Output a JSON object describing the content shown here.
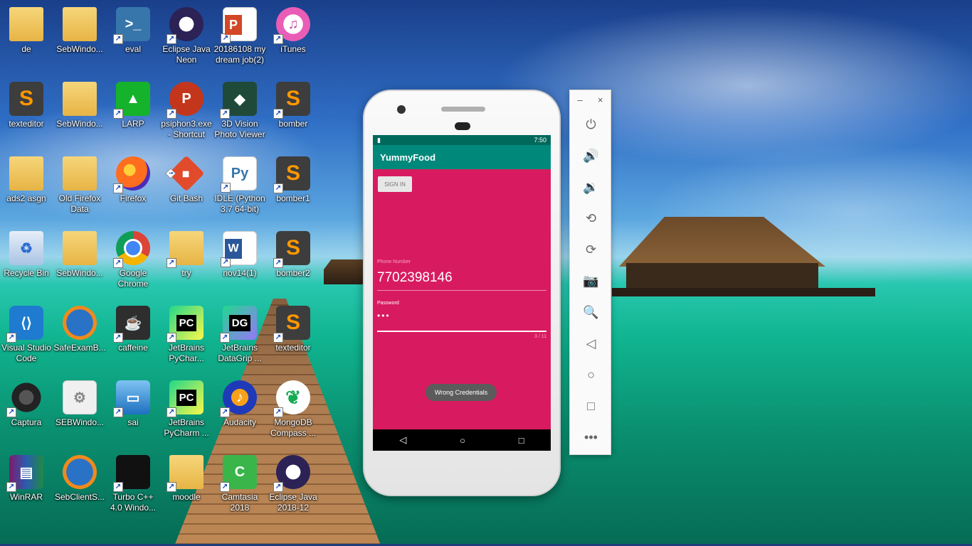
{
  "desktop": {
    "icons": [
      {
        "label": "de",
        "icon": "folder-icon"
      },
      {
        "label": "SebWindo...",
        "icon": "folder-icon"
      },
      {
        "label": "eval",
        "icon": "python-icon"
      },
      {
        "label": "Eclipse Java Neon",
        "icon": "eclipse-icon"
      },
      {
        "label": "20186108 my dream job(2)",
        "icon": "powerpoint-icon"
      },
      {
        "label": "iTunes",
        "icon": "itunes-icon"
      },
      {
        "label": "texteditor",
        "icon": "sublime-icon"
      },
      {
        "label": "SebWindo...",
        "icon": "folder-icon"
      },
      {
        "label": "LARP",
        "icon": "larp-icon"
      },
      {
        "label": "psiphon3.exe - Shortcut",
        "icon": "psiphon-icon"
      },
      {
        "label": "3D Vision Photo Viewer",
        "icon": "3d-vision-icon"
      },
      {
        "label": "bomber",
        "icon": "sublime-icon"
      },
      {
        "label": "ads2 asgn",
        "icon": "folder-icon"
      },
      {
        "label": "Old Firefox Data",
        "icon": "folder-icon"
      },
      {
        "label": "Firefox",
        "icon": "firefox-icon"
      },
      {
        "label": "Git Bash",
        "icon": "git-icon"
      },
      {
        "label": "IDLE (Python 3.7 64-bit)",
        "icon": "python-idle-icon"
      },
      {
        "label": "bomber1",
        "icon": "sublime-icon"
      },
      {
        "label": "Recycle Bin",
        "icon": "recycle-bin-icon"
      },
      {
        "label": "SebWindo...",
        "icon": "folder-icon"
      },
      {
        "label": "Google Chrome",
        "icon": "chrome-icon"
      },
      {
        "label": "try",
        "icon": "folder-icon"
      },
      {
        "label": "nov14(1)",
        "icon": "word-icon"
      },
      {
        "label": "bomber2",
        "icon": "sublime-icon"
      },
      {
        "label": "Visual Studio Code",
        "icon": "vscode-icon"
      },
      {
        "label": "SafeExamB...",
        "icon": "safe-exam-browser-icon"
      },
      {
        "label": "caffeine",
        "icon": "caffeine-icon"
      },
      {
        "label": "JetBrains PyChar...",
        "icon": "pycharm-icon"
      },
      {
        "label": "JetBrains DataGrip ...",
        "icon": "datagrip-icon"
      },
      {
        "label": "texteditor",
        "icon": "sublime-icon"
      },
      {
        "label": "Captura",
        "icon": "captura-icon"
      },
      {
        "label": "SEBWindo...",
        "icon": "settings-file-icon"
      },
      {
        "label": "sai",
        "icon": "computer-icon"
      },
      {
        "label": "JetBrains PyCharm ...",
        "icon": "pycharm-icon"
      },
      {
        "label": "Audacity",
        "icon": "audacity-icon"
      },
      {
        "label": "MongoDB Compass ...",
        "icon": "mongodb-icon"
      },
      {
        "label": "WinRAR",
        "icon": "winrar-icon"
      },
      {
        "label": "SebClientS...",
        "icon": "safe-exam-browser-icon"
      },
      {
        "label": "Turbo C++ 4.0 Windo...",
        "icon": "turbo-cpp-icon"
      },
      {
        "label": "moodle",
        "icon": "folder-icon"
      },
      {
        "label": "Camtasia 2018",
        "icon": "camtasia-icon"
      },
      {
        "label": "Eclipse Java 2018-12",
        "icon": "eclipse-icon"
      }
    ]
  },
  "emulator": {
    "status_time": "7:50",
    "app_title": "YummyFood",
    "sign_in_label": "SIGN IN",
    "phone_label": "Phone Number",
    "phone_value": "7702398146",
    "password_label": "Password",
    "password_value": "•••",
    "password_counter": "3 / 11",
    "toast": "Wrong Credentials",
    "nav": {
      "back": "◁",
      "home": "○",
      "recents": "□"
    }
  },
  "toolbar": {
    "minimize": "–",
    "close": "×",
    "buttons": [
      {
        "name": "power-icon",
        "glyph": "⏻"
      },
      {
        "name": "volume-up-icon",
        "glyph": "🔊"
      },
      {
        "name": "volume-down-icon",
        "glyph": "🔉"
      },
      {
        "name": "rotate-left-icon",
        "glyph": "⟲"
      },
      {
        "name": "rotate-right-icon",
        "glyph": "⟳"
      },
      {
        "name": "camera-icon",
        "glyph": "📷"
      },
      {
        "name": "zoom-icon",
        "glyph": "🔍"
      },
      {
        "name": "back-icon",
        "glyph": "◁"
      },
      {
        "name": "home-icon",
        "glyph": "○"
      },
      {
        "name": "overview-icon",
        "glyph": "□"
      },
      {
        "name": "more-icon",
        "glyph": "•••"
      }
    ]
  },
  "colors": {
    "app_bar": "#00897b",
    "status_bar": "#00695c",
    "screen_bg": "#d81b60",
    "toast_bg": "#5b5b5b"
  }
}
